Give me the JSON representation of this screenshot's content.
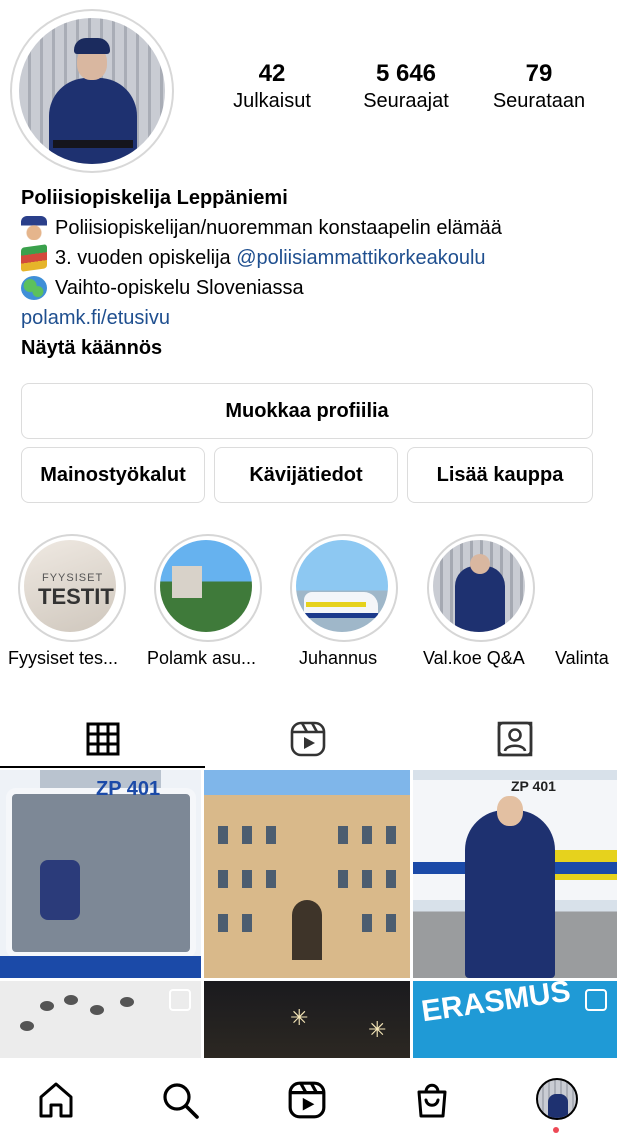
{
  "profile": {
    "posts_count": "42",
    "posts_label": "Julkaisut",
    "followers_count": "5 646",
    "followers_label": "Seuraajat",
    "following_count": "79",
    "following_label": "Seurataan"
  },
  "bio": {
    "name": "Poliisiopiskelija Leppäniemi",
    "line1": "Poliisiopiskelijan/nuoremman konstaapelin elämää",
    "line1_emoji": "police-officer-emoji",
    "line2_prefix": "3. vuoden opiskelija ",
    "line2_mention": "@poliisiammattikorkeakoulu",
    "line2_emoji": "books-emoji",
    "line3": "Vaihto-opiskelu Sloveniassa",
    "line3_emoji": "globe-emoji",
    "link": "polamk.fi/etusivu",
    "translate": "Näytä käännös"
  },
  "buttons": {
    "edit_profile": "Muokkaa profiilia",
    "ad_tools": "Mainostyökalut",
    "insights": "Kävijätiedot",
    "add_shop": "Lisää kauppa"
  },
  "highlights": [
    {
      "label": "Fyysiset tes...",
      "cover_text_small": "FYYSISET",
      "cover_text_large": "TESTIT"
    },
    {
      "label": "Polamk asu..."
    },
    {
      "label": "Juhannus"
    },
    {
      "label": "Val.koe Q&A"
    },
    {
      "label": "Valinta"
    }
  ],
  "tabs": {
    "posts_icon": "grid-icon",
    "reels_icon": "reels-icon",
    "tagged_icon": "tagged-person-icon"
  },
  "posts": {
    "p1_text": "ZP 401",
    "p3_text": "ZP 401",
    "p6_text": "ERASMUS"
  },
  "nav": {
    "home_icon": "home-icon",
    "search_icon": "search-icon",
    "reels_icon": "reels-icon",
    "shop_icon": "shopping-bag-icon",
    "profile_icon": "profile-avatar",
    "notification_color": "#ed4956"
  }
}
